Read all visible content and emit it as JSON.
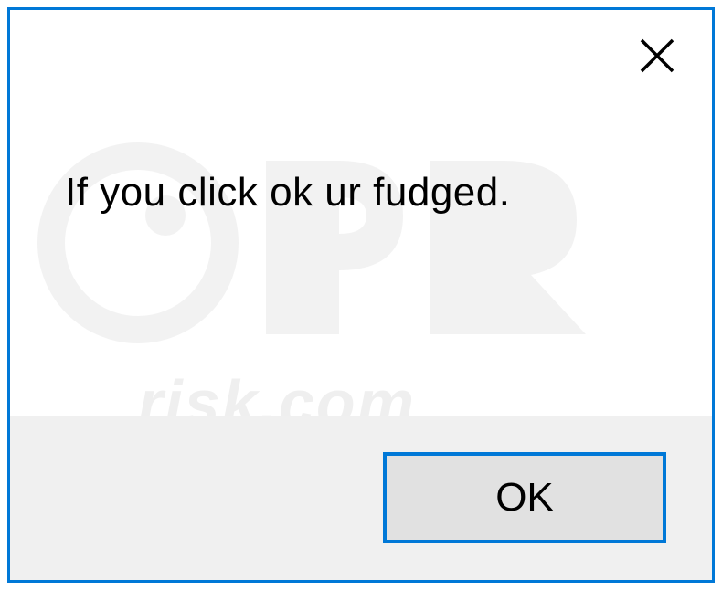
{
  "dialog": {
    "message": "If you click ok ur fudged.",
    "ok_label": "OK"
  },
  "watermark": {
    "text": "risk.com"
  },
  "colors": {
    "border": "#0078d7",
    "button_bg": "#e1e1e1",
    "footer_bg": "#f0f0f0"
  }
}
